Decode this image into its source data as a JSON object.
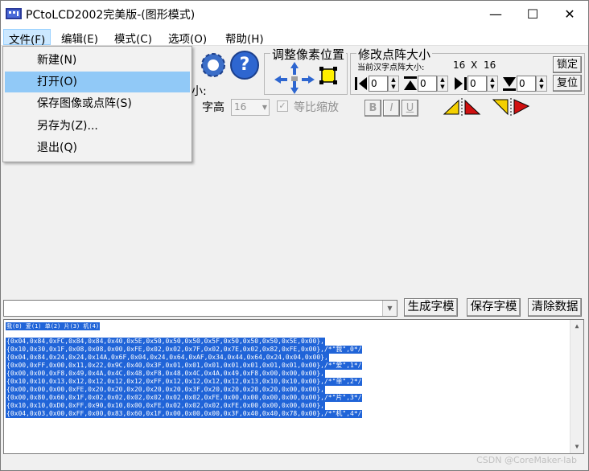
{
  "window": {
    "title": "PCtoLCD2002完美版-(图形模式)",
    "minimize_glyph": "—",
    "maximize_glyph": "☐",
    "close_glyph": "✕"
  },
  "menubar": {
    "items": [
      {
        "label": "文件(F)"
      },
      {
        "label": "编辑(E)"
      },
      {
        "label": "模式(C)"
      },
      {
        "label": "选项(O)"
      },
      {
        "label": "帮助(H)"
      }
    ]
  },
  "file_menu": {
    "items": [
      {
        "label": "新建(N)"
      },
      {
        "label": "打开(O)"
      },
      {
        "label": "保存图像或点阵(S)"
      },
      {
        "label": "另存为(Z)..."
      },
      {
        "label": "退出(Q)"
      }
    ]
  },
  "toolbar": {
    "adjust_position_title": "调整像素位置",
    "resize_title": "修改点阵大小",
    "current_size_label": "当前汉字点阵大小:",
    "width_value": "16",
    "times": "X",
    "height_value": "16",
    "lock_label": "锁定",
    "restore_label": "复位",
    "spin1": "0",
    "spin2": "0",
    "spin3": "0",
    "spin4": "0",
    "size_label_partial": "小:",
    "font_height_label": "字高",
    "font_height_value": "16",
    "proportional_label": "等比缩放",
    "bold_label": "B",
    "italic_label": "I",
    "underline_label": "U",
    "help_glyph": "?"
  },
  "actions": {
    "generate": "生成字模",
    "save": "保存字模",
    "clear": "清除数据"
  },
  "output": {
    "header": "我(0) 爱(1) 单(2) 片(3) 机(4)",
    "lines": [
      "{0x04,0x84,0xFC,0x84,0x84,0x40,0x5E,0x50,0x50,0x50,0x5F,0x50,0x50,0x50,0x5E,0x00},",
      "{0x10,0x30,0x1F,0x08,0x08,0x00,0xFE,0x02,0x02,0x7F,0x02,0x7E,0x02,0x82,0xFE,0x00},/*\"我\",0*/",
      "{0x04,0x84,0x24,0x24,0x14A,0x6F,0x04,0x24,0x64,0xAF,0x34,0x44,0x64,0x24,0x04,0x00},",
      "{0x00,0xFF,0x00,0x11,0x22,0x9C,0x40,0x3F,0x01,0x01,0x01,0x01,0x01,0x01,0x01,0x00},/*\"爱\",1*/",
      "{0x00,0x00,0xF8,0x49,0x4A,0x4C,0x48,0xF8,0x48,0x4C,0x4A,0x49,0xF8,0x00,0x00,0x00},",
      "{0x10,0x10,0x13,0x12,0x12,0x12,0x12,0xFF,0x12,0x12,0x12,0x12,0x13,0x10,0x10,0x00},/*\"单\",2*/",
      "{0x00,0x00,0x00,0xFE,0x20,0x20,0x20,0x20,0x20,0x3F,0x20,0x20,0x20,0x20,0x00,0x00},",
      "{0x00,0x80,0x60,0x1F,0x02,0x02,0x02,0x02,0x02,0x02,0xFE,0x00,0x00,0x00,0x00,0x00},/*\"片\",3*/",
      "{0x10,0x10,0xD0,0xFF,0x90,0x10,0x00,0xFE,0x02,0x02,0x02,0xFE,0x00,0x00,0x00,0x00},",
      "{0x04,0x03,0x00,0xFF,0x00,0x83,0x60,0x1F,0x00,0x00,0x00,0x3F,0x40,0x40,0x78,0x00},/*\"机\",4*/"
    ]
  },
  "watermark": "CSDN @CoreMaker-lab",
  "colors": {
    "selection": "#2064d8",
    "menu_highlight": "#91c9f7",
    "window_bg": "#f0f0f0"
  }
}
